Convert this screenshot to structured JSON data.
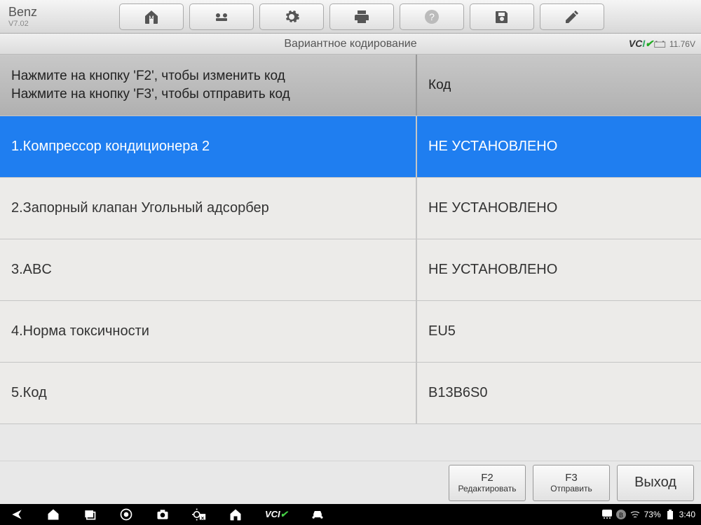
{
  "app": {
    "title": "Benz",
    "version": "V7.02"
  },
  "subheader": {
    "title": "Вариантное кодирование",
    "voltage": "11.76V",
    "vci_label": "VCI"
  },
  "table": {
    "header": {
      "left": "Нажмите на кнопку 'F2', чтобы изменить код\\nНажмите на кнопку 'F3', чтобы отправить код",
      "right": "Код"
    },
    "rows": [
      {
        "label": "1.Компрессор кондиционера 2",
        "value": "НЕ УСТАНОВЛЕНО",
        "selected": true
      },
      {
        "label": "2.Запорный клапан Угольный адсорбер",
        "value": "НЕ УСТАНОВЛЕНО",
        "selected": false
      },
      {
        "label": "3.ABC",
        "value": "НЕ УСТАНОВЛЕНО",
        "selected": false
      },
      {
        "label": "4.Норма токсичности",
        "value": "EU5",
        "selected": false
      },
      {
        "label": "5.Код",
        "value": "B13B6S0",
        "selected": false
      }
    ]
  },
  "footer": {
    "f2_l1": "F2",
    "f2_l2": "Редактировать",
    "f3_l1": "F3",
    "f3_l2": "Отправить",
    "exit": "Выход"
  },
  "android": {
    "battery_pct": "73%",
    "time": "3:40"
  }
}
